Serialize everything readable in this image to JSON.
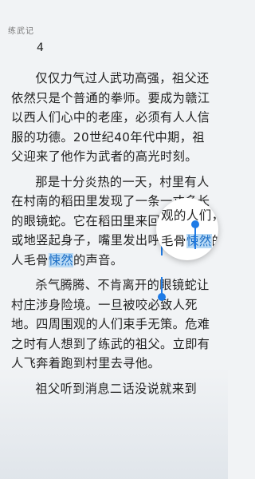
{
  "header": {
    "book_title": "练武记"
  },
  "chapter": {
    "number": "4"
  },
  "paragraphs": [
    {
      "text": "仅仅力气过人武功高强，祖父还依然只是个普通的拳师。要成为赣江以西人们心中的老座，必须有人人信服的功德。20世纪40年代中期，祖父迎来了他作为武者的高光时刻。"
    },
    {
      "before": "那是十分炎热的一天，村里有人在村南的稻田里发现了一条一丈多长的眼镜蛇。它在稻田里来回游行，间或地竖起身子，嘴里发出呼呼呼的让人毛骨",
      "highlight": "悚然",
      "after": "的声音。"
    },
    {
      "text": "杀气腾腾、不肯离开的眼镜蛇让村庄涉身险境。一旦被咬必致人死地。四周围观的人们束手无策。危难之时有人想到了练武的祖父。立即有人飞奔着跑到村里去寻他。"
    },
    {
      "text": "祖父听到消息二话没说就来到"
    }
  ],
  "magnifier": {
    "line1": "观的人们，",
    "line2_before": "毛骨",
    "line2_highlight": "悚然",
    "line2_after": "的声"
  },
  "colors": {
    "selection": "#b9daf5",
    "handle": "#1e7be6",
    "background": "#f1f3f5"
  }
}
